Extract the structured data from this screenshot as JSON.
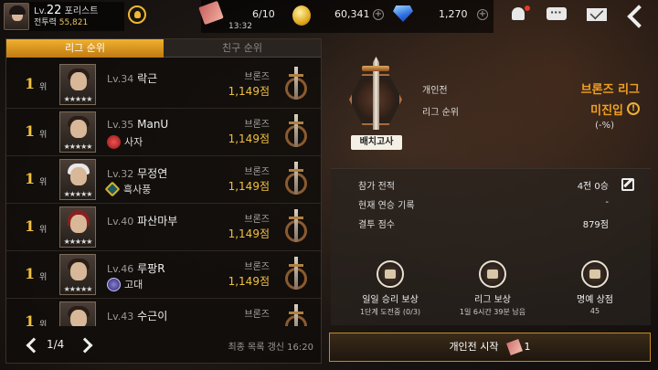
{
  "player": {
    "level_prefix": "Lv.",
    "level": "22",
    "class_name": "포리스트",
    "power_label": "전투력",
    "power_value": "55,821"
  },
  "resources": {
    "stamina": "6/10",
    "stamina_timer": "13:32",
    "gold": "60,341",
    "gems": "1,270"
  },
  "tabs": [
    {
      "label": "리그 순위",
      "active": true
    },
    {
      "label": "친구 순위",
      "active": false
    }
  ],
  "rankings": [
    {
      "rank": "1",
      "unit": "위",
      "level": "Lv.34",
      "name": "락근",
      "guild": "",
      "guild_icon": "none",
      "tier": "브론즈",
      "score": "1,149점",
      "portrait": "dark-hair"
    },
    {
      "rank": "1",
      "unit": "위",
      "level": "Lv.35",
      "name": "ManU",
      "guild": "사자",
      "guild_icon": "red",
      "tier": "브론즈",
      "score": "1,149점",
      "portrait": "dark-hair"
    },
    {
      "rank": "1",
      "unit": "위",
      "level": "Lv.32",
      "name": "무정연",
      "guild": "흑사풍",
      "guild_icon": "teal",
      "tier": "브론즈",
      "score": "1,149점",
      "portrait": "white-hair"
    },
    {
      "rank": "1",
      "unit": "위",
      "level": "Lv.40",
      "name": "파산마부",
      "guild": "",
      "guild_icon": "none",
      "tier": "브론즈",
      "score": "1,149점",
      "portrait": "helm"
    },
    {
      "rank": "1",
      "unit": "위",
      "level": "Lv.46",
      "name": "루팡R",
      "guild": "고대",
      "guild_icon": "purple",
      "tier": "브론즈",
      "score": "1,149점",
      "portrait": "dark-hair"
    },
    {
      "rank": "1",
      "unit": "위",
      "level": "Lv.43",
      "name": "수근이",
      "guild": "",
      "guild_icon": "none",
      "tier": "브론즈",
      "score": "",
      "portrait": "dark-hair"
    }
  ],
  "pager": {
    "page": "1/4",
    "updated": "최종 목록 갱신 16:20"
  },
  "league": {
    "placement_tag": "배치고사",
    "mode_label": "개인전",
    "league_name": "브론즈 리그",
    "rank_label": "리그 순위",
    "rank_value": "미진입",
    "rank_pct": "(-%)"
  },
  "stats": [
    {
      "label": "참가 전적",
      "value": "4전 0승"
    },
    {
      "label": "현재 연승 기록",
      "value": "-"
    },
    {
      "label": "결투 점수",
      "value": "879점"
    }
  ],
  "rewards": [
    {
      "title": "일일 승리 보상",
      "sub": "1단계 도전중 (0/3)",
      "icon": "chest-icon"
    },
    {
      "title": "리그 보상",
      "sub": "1일 6시간 39분 남음",
      "icon": "chest-icon"
    },
    {
      "title": "명예 상점",
      "sub": "45",
      "icon": "shop-basket-icon"
    }
  ],
  "start_button": {
    "label": "개인전 시작",
    "ticket_count": "1"
  },
  "colors": {
    "accent_gold": "#f0c040",
    "league_orange": "#f0a020",
    "tab_active": "#e8a020"
  }
}
